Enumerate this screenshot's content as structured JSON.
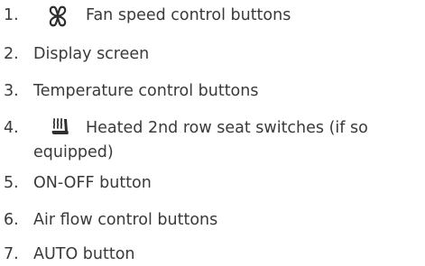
{
  "items": [
    {
      "num": "1.",
      "icon": "fan-icon",
      "text": "Fan speed control buttons"
    },
    {
      "num": "2.",
      "text": "Display screen"
    },
    {
      "num": "3.",
      "text": "Temperature control buttons"
    },
    {
      "num": "4.",
      "icon": "heated-seat-icon",
      "text": "Heated 2nd row seat switches (if so",
      "text2": "equipped)"
    },
    {
      "num": "5.",
      "text": "ON-OFF button"
    },
    {
      "num": "6.",
      "text": "Air flow control buttons"
    },
    {
      "num": "7.",
      "text": "AUTO button"
    }
  ],
  "colors": {
    "text": "#3a3a3a"
  }
}
